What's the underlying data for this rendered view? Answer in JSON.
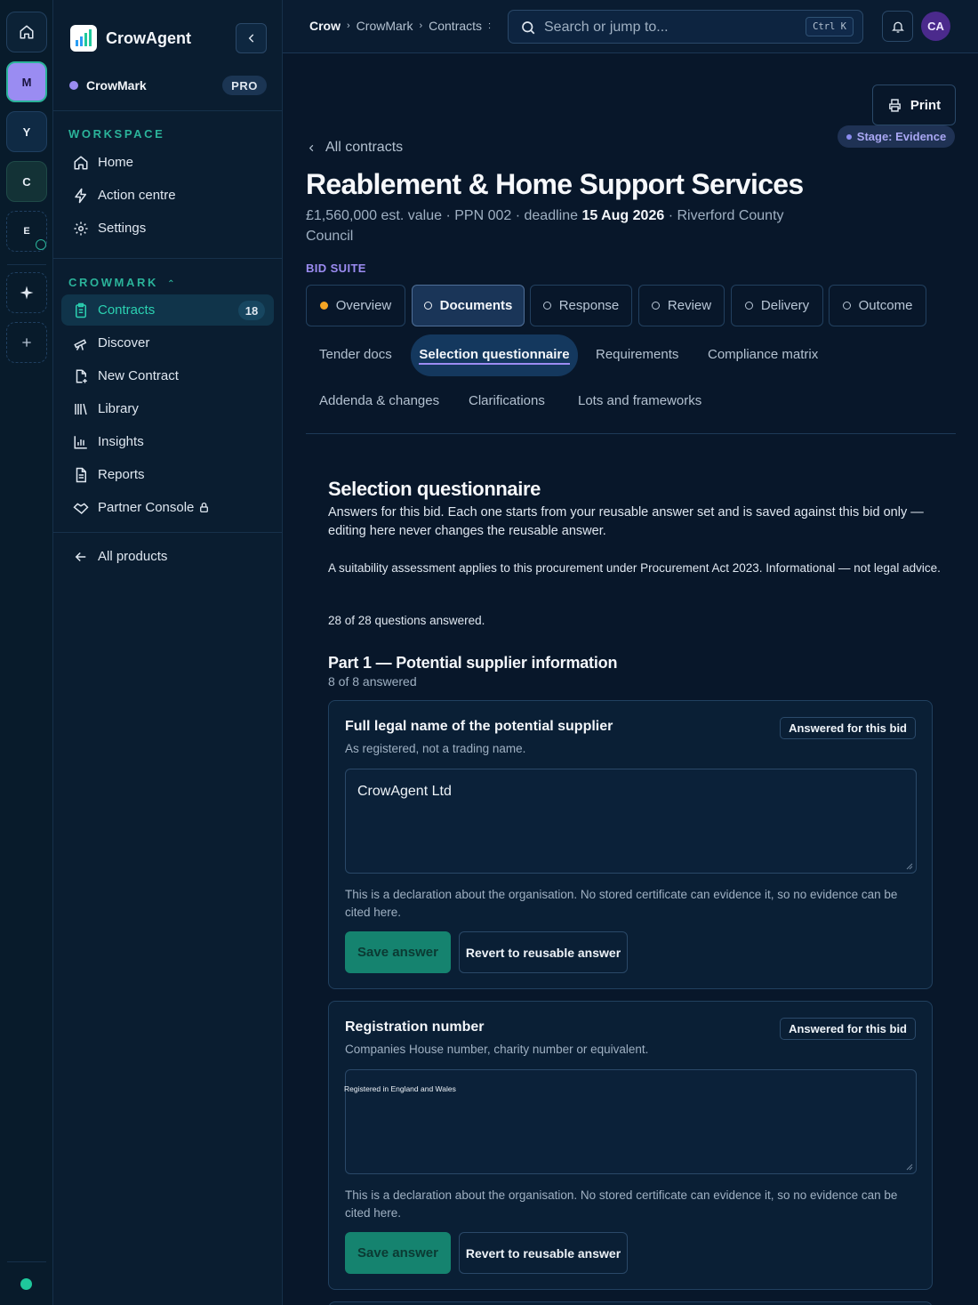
{
  "rail": {
    "workspaces": [
      "M",
      "Y",
      "C",
      "E"
    ]
  },
  "sidebar": {
    "brand": "CrowAgent",
    "org_name": "CrowMark",
    "plan_badge": "PRO",
    "workspace_label": "WORKSPACE",
    "workspace_items": [
      {
        "label": "Home",
        "icon": "home-icon"
      },
      {
        "label": "Action centre",
        "icon": "bolt-icon"
      },
      {
        "label": "Settings",
        "icon": "gear-icon"
      }
    ],
    "product_label": "CROWMARK",
    "product_items": [
      {
        "label": "Contracts",
        "icon": "clipboard-icon",
        "count": "18",
        "active": true
      },
      {
        "label": "Discover",
        "icon": "telescope-icon"
      },
      {
        "label": "New Contract",
        "icon": "new-document-icon"
      },
      {
        "label": "Library",
        "icon": "library-icon"
      },
      {
        "label": "Insights",
        "icon": "bar-chart-icon"
      },
      {
        "label": "Reports",
        "icon": "report-icon"
      },
      {
        "label": "Partner Console",
        "icon": "handshake-icon"
      }
    ],
    "all_products": "All products"
  },
  "topbar": {
    "breadcrumb": [
      "Crow",
      "CrowMark",
      "Contracts"
    ],
    "search_placeholder": "Search or jump to...",
    "search_shortcut": "Ctrl K",
    "avatar_initials": "CA"
  },
  "page": {
    "print_label": "Print",
    "stage_label": "Stage: Evidence",
    "back_link": "All contracts",
    "title": "Reablement & Home Support Services",
    "meta_value": "£1,560,000 est. value",
    "meta_ppn": "PPN 002",
    "meta_deadline_label": "deadline",
    "meta_deadline": "15 Aug 2026",
    "meta_buyer": "Riverford County Council",
    "suite_label": "BID SUITE",
    "tabs": [
      "Overview",
      "Documents",
      "Response",
      "Review",
      "Delivery",
      "Outcome"
    ],
    "subtabs_row1": [
      "Tender docs",
      "Selection questionnaire",
      "Requirements",
      "Compliance matrix"
    ],
    "subtabs_row2": [
      "Addenda & changes",
      "Clarifications",
      "Lots and frameworks"
    ],
    "section_title": "Selection questionnaire",
    "intro": "Answers for this bid. Each one starts from your reusable answer set and is saved against this bid only — editing here never changes the reusable answer.",
    "notice": "A suitability assessment applies to this procurement under Procurement Act 2023. Informational — not legal advice.",
    "progress": "28 of 28 questions answered.",
    "part_title": "Part 1 — Potential supplier information",
    "part_progress": "8 of 8 answered"
  },
  "questions": [
    {
      "title": "Full legal name of the potential supplier",
      "subtitle": "As registered, not a trading name.",
      "badge": "Answered for this bid",
      "answer": "CrowAgent Ltd",
      "note": "This is a declaration about the organisation. No stored certificate can evidence it, so no evidence can be cited here.",
      "save_label": "Save answer",
      "revert_label": "Revert to reusable answer"
    },
    {
      "title": "Registration number",
      "subtitle": "Companies House number, charity number or equivalent.",
      "badge": "Answered for this bid",
      "answer": "Registered in England and Wales",
      "note": "This is a declaration about the organisation. No stored certificate can evidence it, so no evidence can be cited here.",
      "save_label": "Save answer",
      "revert_label": "Revert to reusable answer"
    }
  ],
  "colors": {
    "accent": "#2bb39a",
    "stage_dot": "#8b8cf0",
    "overview_dot": "#f5a524",
    "workspace_m": "#9a8cf2",
    "status_dot": "#1fc89c"
  }
}
